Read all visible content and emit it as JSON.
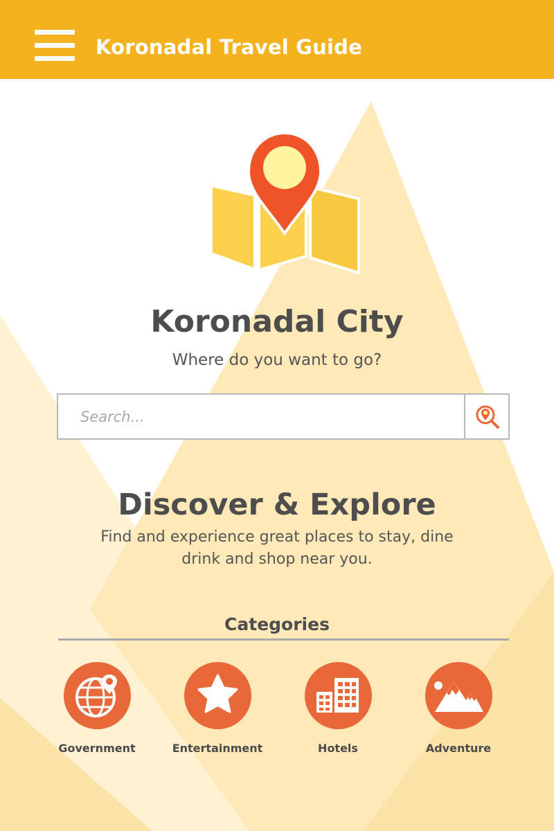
{
  "colors": {
    "header": "#f5b21f",
    "accent": "#e9683a",
    "pin": "#ef5328",
    "pin_center": "#fff4a0",
    "map_light": "#fdd04e",
    "map_dark": "#f8c93f",
    "mountain_light": "#fff1d1",
    "mountain_mid": "#ffe9b8",
    "mountain_dark": "#fbe2a7"
  },
  "header": {
    "title": "Koronadal Travel Guide",
    "menu_icon": "hamburger-menu-icon"
  },
  "hero": {
    "icon": "map-pin-icon",
    "title": "Koronadal City",
    "subtitle": "Where do you want to go?"
  },
  "search": {
    "placeholder": "Search...",
    "value": "",
    "button_icon": "location-search-icon"
  },
  "discover": {
    "title": "Discover & Explore",
    "description_line1": "Find and experience great places to stay, dine",
    "description_line2": "drink and shop near you."
  },
  "categories": {
    "title": "Categories",
    "items": [
      {
        "label": "Government",
        "icon": "globe-pin-icon"
      },
      {
        "label": "Entertainment",
        "icon": "star-icon"
      },
      {
        "label": "Hotels",
        "icon": "buildings-icon"
      },
      {
        "label": "Adventure",
        "icon": "mountains-icon"
      }
    ]
  }
}
